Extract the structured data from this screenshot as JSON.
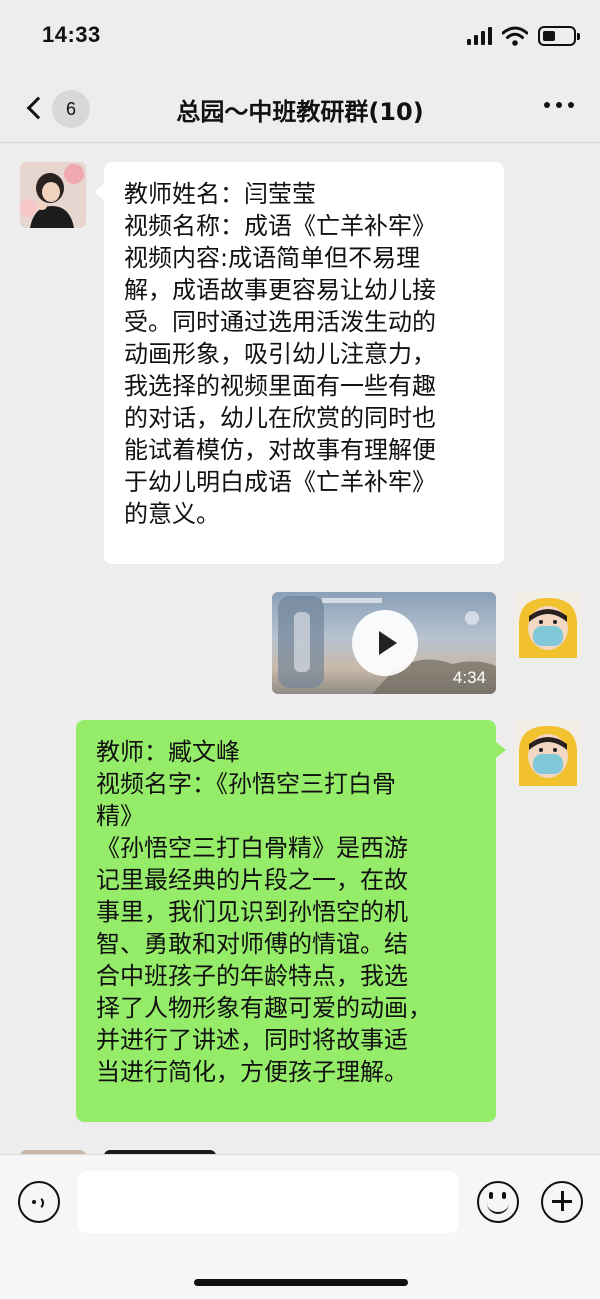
{
  "status_bar": {
    "time": "14:33"
  },
  "nav": {
    "unread_count": "6",
    "title": "总园～中班教研群(10)"
  },
  "messages": {
    "m1": {
      "lines": [
        "教师姓名：闫莹莹",
        "视频名称：成语《亡羊补牢》",
        "视频内容:成语简单但不易理",
        "解，成语故事更容易让幼儿接",
        "受。同时通过选用活泼生动的",
        "动画形象，吸引幼儿注意力，",
        "我选择的视频里面有一些有趣",
        "的对话，幼儿在欣赏的同时也",
        "能试着模仿，对故事有理解便",
        "于幼儿明白成语《亡羊补牢》",
        "的意义。"
      ]
    },
    "m2": {
      "video_duration": "4:34"
    },
    "m3": {
      "lines": [
        "教师：臧文峰",
        "视频名字：《孙悟空三打白骨",
        "精》",
        "《孙悟空三打白骨精》是西游",
        "记里最经典的片段之一，在故",
        "事里，我们见识到孙悟空的机",
        "智、勇敢和对师傅的情谊。结",
        "合中班孩子的年龄特点，我选",
        "择了人物形象有趣可爱的动画，",
        "并进行了讲述，同时将故事适",
        "当进行简化，方便孩子理解。"
      ]
    }
  },
  "colors": {
    "background": "#ededed",
    "outgoing_bubble": "#95ec69",
    "incoming_bubble": "#ffffff"
  },
  "icons": [
    "back-chevron-icon",
    "more-icon",
    "play-icon",
    "voice-icon",
    "emoji-icon",
    "plus-icon"
  ]
}
